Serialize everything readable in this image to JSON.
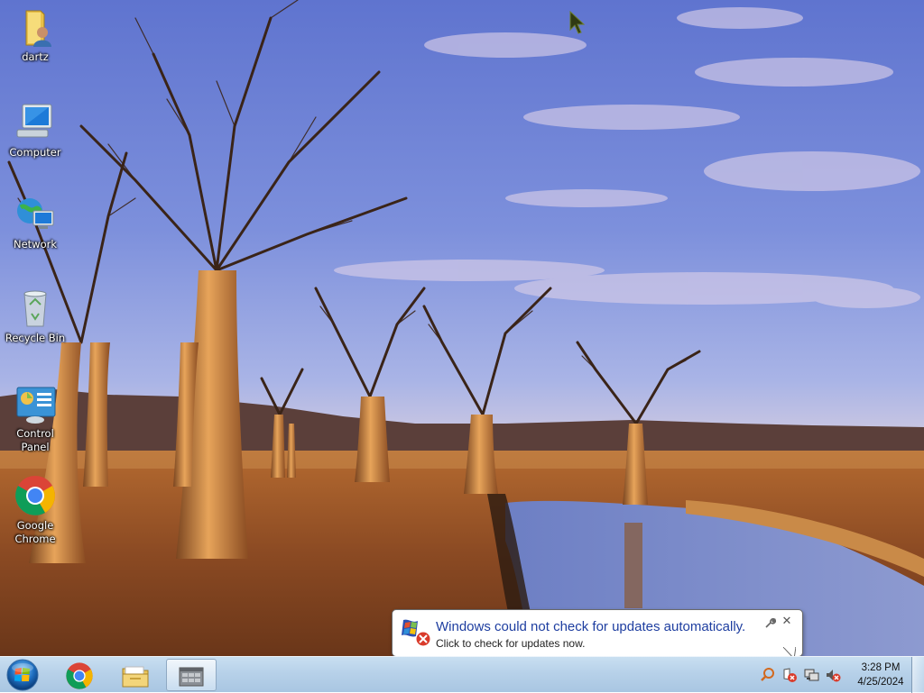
{
  "desktop": {
    "icons": [
      {
        "label": "dartz",
        "icon": "user-folder-icon"
      },
      {
        "label": "Computer",
        "icon": "computer-icon"
      },
      {
        "label": "Network",
        "icon": "network-icon"
      },
      {
        "label": "Recycle Bin",
        "icon": "recycle-bin-icon"
      },
      {
        "label": "Control Panel",
        "icon": "control-panel-icon"
      },
      {
        "label_line1": "Google",
        "label_line2": "Chrome",
        "icon": "chrome-icon"
      }
    ]
  },
  "notification": {
    "title": "Windows could not check for updates automatically.",
    "text": "Click to check for updates now.",
    "icon": "windows-update-error-icon"
  },
  "taskbar": {
    "pinned": [
      {
        "name": "chrome",
        "icon": "chrome-icon"
      },
      {
        "name": "explorer",
        "icon": "folder-icon"
      },
      {
        "name": "app",
        "icon": "window-grid-icon",
        "active": true
      }
    ],
    "tray": {
      "icons": [
        "search-icon",
        "action-center-error-icon",
        "network-icon",
        "volume-muted-icon"
      ],
      "time": "3:28 PM",
      "date": "4/25/2024"
    }
  },
  "colors": {
    "taskbar": "#b7d1e9",
    "notification_title": "#1e3ea0",
    "sky": "#6f86d6"
  }
}
